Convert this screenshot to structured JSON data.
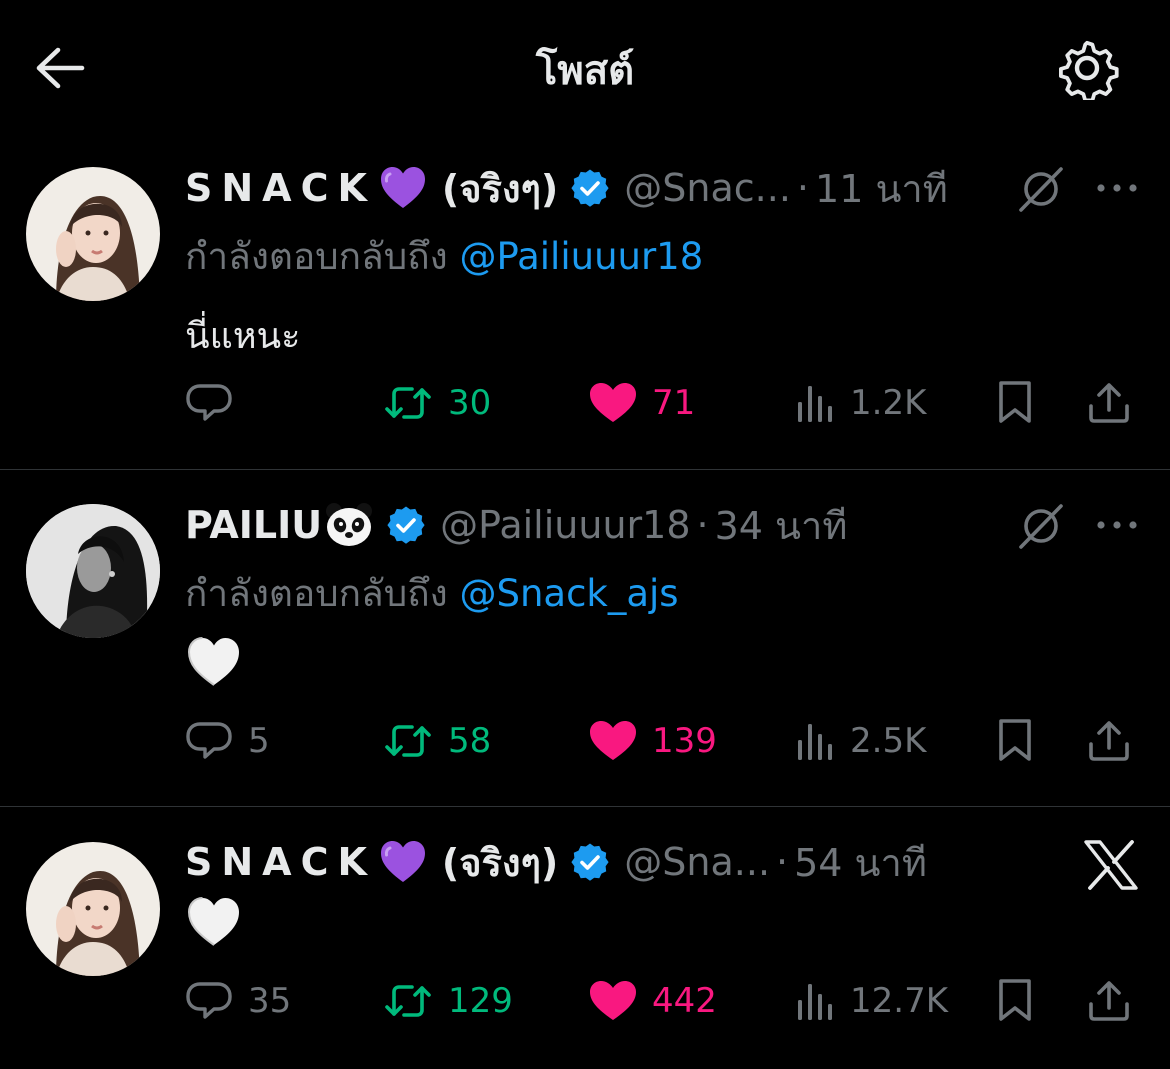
{
  "header": {
    "title": "โพสต์"
  },
  "colors": {
    "background": "#000000",
    "text_primary": "#e7e9ea",
    "text_secondary": "#71767b",
    "link": "#1d9bf0",
    "retweet": "#00ba7c",
    "like": "#f91880",
    "verified": "#1d9bf0"
  },
  "posts": [
    {
      "name": "SNACK",
      "name_emoji": "purple-heart",
      "name_suffix": "(จริงๆ)",
      "verified": true,
      "handle": "@Snac...",
      "separator": "·",
      "time": "11 นาที",
      "top_right_icon": "grok-icon",
      "replying_prefix": "กำลังตอบกลับถึง",
      "replying_to": "@Pailiuuur18",
      "text": "นี่แหนะ",
      "reply_count": "",
      "retweet_count": "30",
      "like_count": "71",
      "view_count": "1.2K"
    },
    {
      "name": "PAILIU",
      "name_emoji": "panda",
      "name_suffix": "",
      "verified": true,
      "handle": "@Pailiuuur18",
      "separator": "·",
      "time": "34 นาที",
      "top_right_icon": "grok-icon",
      "replying_prefix": "กำลังตอบกลับถึง",
      "replying_to": "@Snack_ajs",
      "text_emoji": "white-heart",
      "reply_count": "5",
      "retweet_count": "58",
      "like_count": "139",
      "view_count": "2.5K"
    },
    {
      "name": "SNACK",
      "name_emoji": "purple-heart",
      "name_suffix": "(จริงๆ)",
      "verified": true,
      "handle": "@Sna...",
      "separator": "·",
      "time": "54 นาที",
      "top_right_icon": "x-logo-icon",
      "text_emoji": "white-heart",
      "reply_count": "35",
      "retweet_count": "129",
      "like_count": "442",
      "view_count": "12.7K"
    }
  ]
}
